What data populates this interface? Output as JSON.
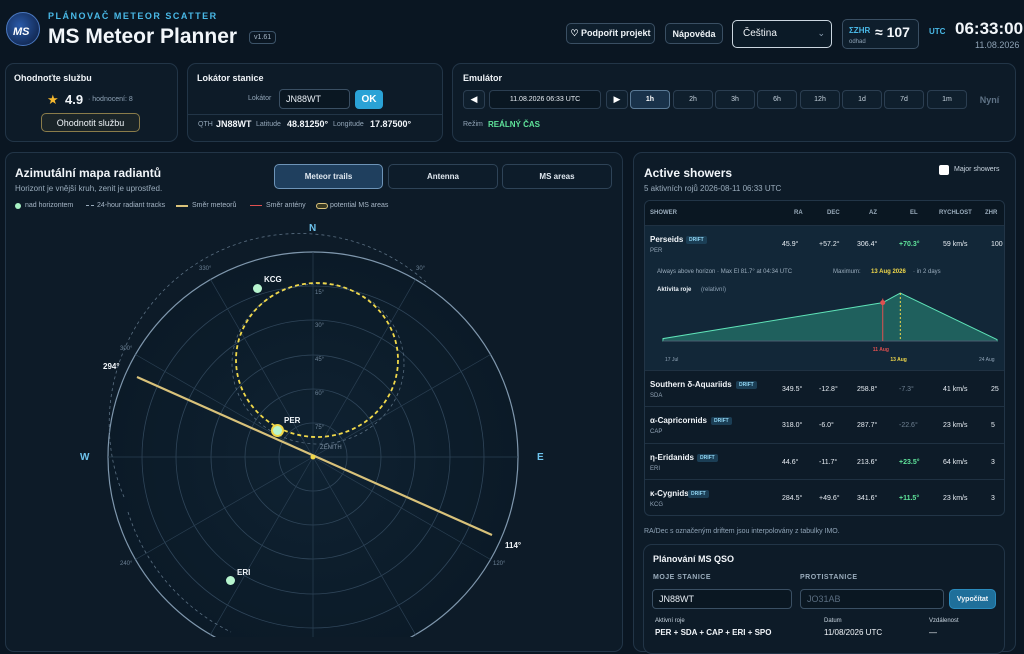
{
  "header": {
    "subtitle": "PLÁNOVAČ METEOR SCATTER",
    "title": "MS Meteor Planner",
    "version": "v1.61",
    "logo_text": "MS",
    "support_label": "♡ Podpořit projekt",
    "help_label": "Nápověda",
    "language": "Čeština",
    "zhr_key": "ΣZHR",
    "zhr_value": "≈ 107",
    "zhr_note": "odhad",
    "utc_label": "UTC",
    "time": "06:33:00",
    "date": "11.08.2026"
  },
  "rating": {
    "title": "Ohodnoťte službu",
    "score": "4.9",
    "count": "· hodnocení: 8",
    "button": "Ohodnotit službu"
  },
  "station": {
    "title": "Lokátor stanice",
    "locator_label": "Lokátor",
    "locator": "JN88WT",
    "ok": "OK",
    "qth_label": "QTH",
    "qth": "JN88WT",
    "lat_label": "Latitude",
    "lat": "48.81250°",
    "lon_label": "Longitude",
    "lon": "17.87500°"
  },
  "emulator": {
    "title": "Emulátor",
    "datetime": "11.08.2026 06:33 UTC",
    "steps": [
      "1h",
      "2h",
      "3h",
      "6h",
      "12h",
      "1d",
      "7d",
      "1m"
    ],
    "now": "Nyní",
    "mode_label": "Režim",
    "mode": "REÁLNÝ ČAS"
  },
  "map": {
    "title": "Azimutální mapa radiantů",
    "desc": "Horizont je vnější kruh, zenit je uprostřed.",
    "tabs": [
      "Meteor trails",
      "Antenna",
      "MS areas"
    ],
    "legend": [
      "nad horizontem",
      "24-hour radiant tracks",
      "Směr meteorů",
      "Směr antény",
      "potential MS areas"
    ],
    "compass": {
      "n": "N",
      "w": "W",
      "e": "E"
    },
    "az_labels": [
      "330°",
      "30°",
      "300°",
      "240°",
      "120°"
    ],
    "alt_labels": [
      "15°",
      "30°",
      "45°",
      "60°",
      "75°"
    ],
    "zenith": "ZENITH",
    "dir_start": "294°",
    "dir_end": "114°",
    "radiants": [
      {
        "name": "KCG"
      },
      {
        "name": "PER"
      },
      {
        "name": "ERI"
      }
    ]
  },
  "showers": {
    "title": "Active showers",
    "sub": "5 aktivních rojů 2026-08-11 06:33 UTC",
    "major_label": "Major showers",
    "columns": [
      "SHOWER",
      "RA",
      "DEC",
      "AZ",
      "EL",
      "RYCHLOST",
      "ZHR"
    ],
    "drift": "DRIFT",
    "rows": [
      {
        "name": "Perseids",
        "code": "PER",
        "ra": "45.9°",
        "dec": "+57.2°",
        "az": "306.4°",
        "el": "+70.3°",
        "v": "59 km/s",
        "zhr": "100"
      },
      {
        "name": "Southern δ-Aquariids",
        "code": "SDA",
        "ra": "349.5°",
        "dec": "-12.8°",
        "az": "258.8°",
        "el": "-7.3°",
        "v": "41 km/s",
        "zhr": "25"
      },
      {
        "name": "α-Capricornids",
        "code": "CAP",
        "ra": "318.0°",
        "dec": "-6.0°",
        "az": "287.7°",
        "el": "-22.6°",
        "v": "23 km/s",
        "zhr": "5"
      },
      {
        "name": "η-Eridanids",
        "code": "ERI",
        "ra": "44.6°",
        "dec": "-11.7°",
        "az": "213.6°",
        "el": "+23.5°",
        "v": "64 km/s",
        "zhr": "3"
      },
      {
        "name": "κ-Cygnids",
        "code": "KCG",
        "ra": "284.5°",
        "dec": "+49.6°",
        "az": "341.6°",
        "el": "+11.5°",
        "v": "23 km/s",
        "zhr": "3"
      }
    ],
    "detail": {
      "horizon": "Always above horizon · Max El 81.7° at 04:34 UTC",
      "max_label": "Maximum:",
      "max_date": "13 Aug 2026",
      "max_rel": "· in 2 days",
      "activity": "Aktivita roje",
      "activity_rel": "(relativní)",
      "x_start": "17 Jul",
      "x_now": "11 Aug",
      "x_max": "13 Aug",
      "x_end": "24 Aug"
    },
    "note": "RA/Dec s označeným driftem jsou interpolovány z tabulky IMO."
  },
  "qso": {
    "title": "Plánování MS QSO",
    "my_label": "MOJE STANICE",
    "other_label": "PROTISTANICE",
    "my": "JN88WT",
    "other_placeholder": "JO31AB",
    "calc": "Vypočítat",
    "active_label": "Aktivní roje",
    "active": "PER + SDA + CAP + ERI + SPO",
    "date_label": "Datum",
    "date": "11/08/2026 UTC",
    "dist_label": "Vzdálenost",
    "dist": "—"
  },
  "chart_data": {
    "type": "area",
    "title": "Aktivita roje",
    "x": [
      "17 Jul",
      "11 Aug",
      "13 Aug",
      "24 Aug"
    ],
    "values": [
      0.05,
      0.8,
      1.0,
      0.03
    ]
  }
}
